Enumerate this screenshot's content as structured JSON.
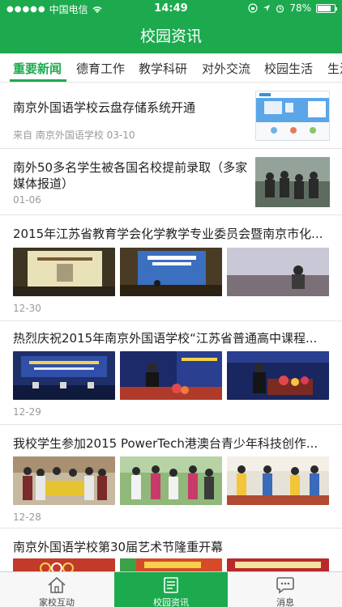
{
  "status_bar": {
    "carrier": "中国电信",
    "time": "14:49",
    "battery": "78%",
    "battery_level": 0.78
  },
  "header": {
    "title": "校园资讯"
  },
  "tabs": [
    {
      "label": "重要新闻",
      "active": true
    },
    {
      "label": "德育工作"
    },
    {
      "label": "教学科研"
    },
    {
      "label": "对外交流"
    },
    {
      "label": "校园生活"
    },
    {
      "label": "生活"
    }
  ],
  "news": [
    {
      "title": "南京外国语学校云盘存储系统开通",
      "meta": "来自 南京外国语学校 03-10"
    },
    {
      "title": "南外50多名学生被各国名校提前录取（多家媒体报道）",
      "meta": "01-06"
    },
    {
      "title": "2015年江苏省教育学会化学教学专业委员会暨南京市化...",
      "meta": "12-30"
    },
    {
      "title": "热烈庆祝2015年南京外国语学校“江苏省普通高中课程...",
      "meta": "12-29"
    },
    {
      "title": "我校学生参加2015 PowerTech港澳台青少年科技创作...",
      "meta": "12-28"
    },
    {
      "title": "南京外国语学校第30届艺术节隆重开幕",
      "meta": ""
    }
  ],
  "tabbar": [
    {
      "label": "家校互动",
      "icon": "home-icon"
    },
    {
      "label": "校园资讯",
      "icon": "news-icon",
      "active": true
    },
    {
      "label": "消息",
      "icon": "chat-icon"
    }
  ],
  "colors": {
    "accent": "#1daa4e"
  }
}
